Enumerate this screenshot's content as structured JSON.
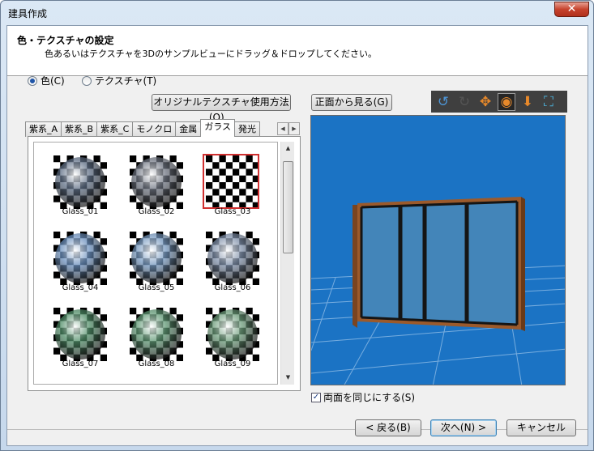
{
  "window": {
    "title": "建具作成",
    "close": "✕"
  },
  "header": {
    "title": "色・テクスチャの設定",
    "subtitle": "色あるいはテクスチャを3Dのサンプルビューにドラッグ＆ドロップしてください。"
  },
  "mode": {
    "color_label": "色(C)",
    "color_selected": true,
    "texture_label": "テクスチャ(T)",
    "texture_selected": false
  },
  "buttons": {
    "original_texture": "オリジナルテクスチャ使用方法(Q)...",
    "front_view": "正面から見る(G)",
    "back": "< 戻る(B)",
    "next": "次へ(N) >",
    "cancel": "キャンセル"
  },
  "tabs": [
    "紫系_A",
    "紫系_B",
    "紫系_C",
    "モノクロ",
    "金属",
    "ガラス",
    "発光"
  ],
  "active_tab": "ガラス",
  "swatches": [
    {
      "label": "Glass_01",
      "tint": "#5e6e85",
      "selected": false
    },
    {
      "label": "Glass_02",
      "tint": "#6d7380",
      "selected": false
    },
    {
      "label": "Glass_03",
      "tint": "#8a8c90",
      "selected": true
    },
    {
      "label": "Glass_04",
      "tint": "#6a8fbd",
      "selected": false
    },
    {
      "label": "Glass_05",
      "tint": "#7598bf",
      "selected": false
    },
    {
      "label": "Glass_06",
      "tint": "#7d8ea8",
      "selected": false
    },
    {
      "label": "Glass_07",
      "tint": "#4e8c66",
      "selected": false
    },
    {
      "label": "Glass_08",
      "tint": "#5d9672",
      "selected": false
    },
    {
      "label": "Glass_09",
      "tint": "#6a9a78",
      "selected": false
    }
  ],
  "toolbar": [
    "rotate-left-icon",
    "rotate-right-icon",
    "move-icon",
    "orbit-icon",
    "down-arrow-icon",
    "fit-view-icon"
  ],
  "preview": {
    "background": "#1b73c4",
    "frame_color": "#9b5a2c"
  },
  "double_sided": {
    "label": "両面を同じにする(S)",
    "checked": true
  }
}
